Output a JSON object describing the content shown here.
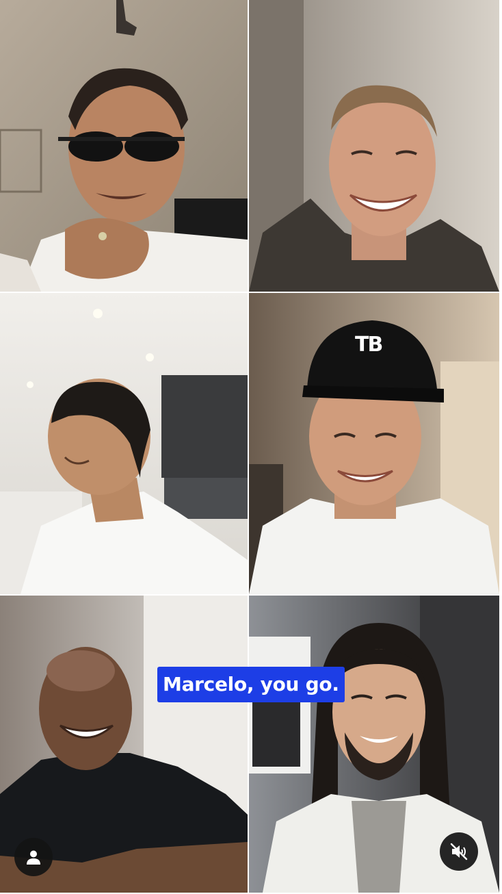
{
  "caption": {
    "text": "Marcelo, you go."
  },
  "controls": {
    "profile_icon": "user-icon",
    "mute_icon": "speaker-muted-icon"
  },
  "tiles": [
    {
      "name": "participant-1",
      "cap_logo": ""
    },
    {
      "name": "participant-2",
      "cap_logo": ""
    },
    {
      "name": "participant-3",
      "cap_logo": ""
    },
    {
      "name": "participant-4",
      "cap_logo": "TB"
    },
    {
      "name": "participant-5",
      "cap_logo": ""
    },
    {
      "name": "participant-6",
      "cap_logo": ""
    }
  ],
  "colors": {
    "caption_bg": "#1d3ee6",
    "caption_text": "#ffffff",
    "button_bg": "#141414"
  }
}
